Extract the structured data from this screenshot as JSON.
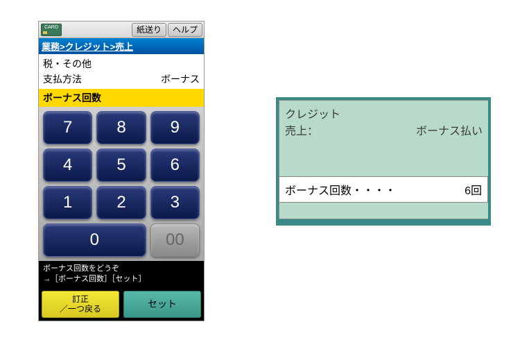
{
  "topbar": {
    "card_label": "CARD",
    "paper_feed": "紙送り",
    "help": "ヘルプ"
  },
  "breadcrumb": "業務>クレジット>売上",
  "info": {
    "tax_other": "税・その他",
    "pay_method_label": "支払方法",
    "pay_method_value": "ボーナス"
  },
  "field_label": "ボーナス回数",
  "keys": {
    "k7": "7",
    "k8": "8",
    "k9": "9",
    "k4": "4",
    "k5": "5",
    "k6": "6",
    "k1": "1",
    "k2": "2",
    "k3": "3",
    "k0": "0",
    "k00": "00"
  },
  "prompt": {
    "line1": "ボーナス回数をどうぞ",
    "line2": "→［ボーナス回数］［セット］"
  },
  "buttons": {
    "correct": "訂正\n／一つ戻る",
    "set": "セット"
  },
  "receipt": {
    "line1": "クレジット",
    "line2_left": "売上：",
    "line2_right": "ボーナス払い",
    "count_label": "ボーナス回数・・・・",
    "count_value": "6回"
  }
}
